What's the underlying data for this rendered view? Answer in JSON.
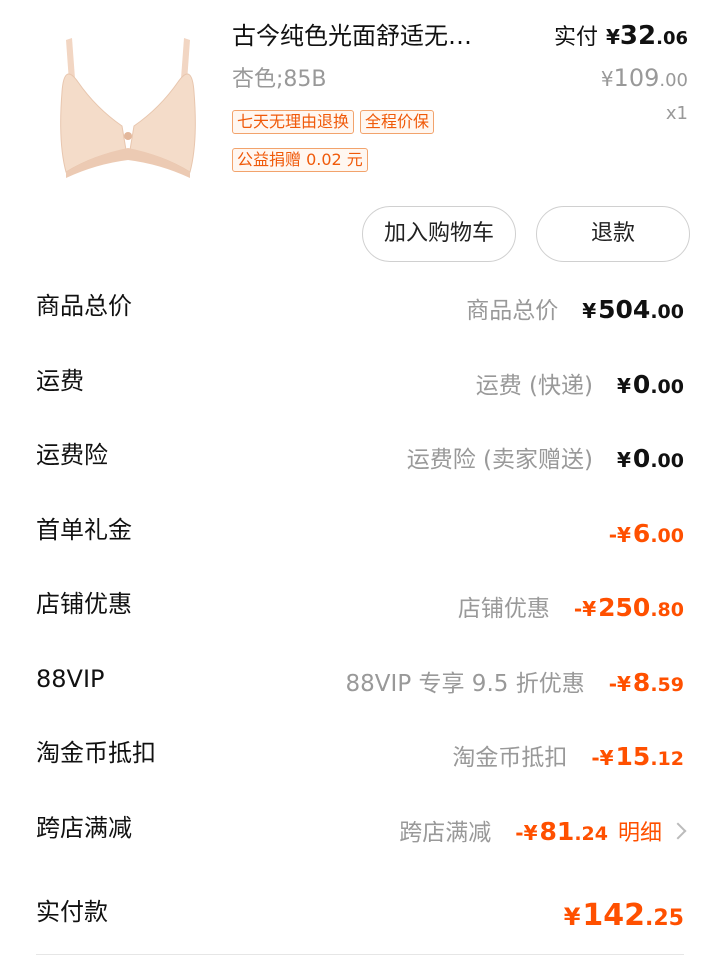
{
  "product": {
    "name": "古今纯色光面舒适无…",
    "sku": "杏色;85B",
    "tags": [
      "七天无理由退换",
      "全程价保",
      "公益捐赠 0.02 元"
    ],
    "paid_label": "实付",
    "paid_symbol": "¥",
    "paid_int": "32",
    "paid_dec": ".06",
    "orig_symbol": "¥",
    "orig_int": "109",
    "orig_dec": ".00",
    "quantity": "x1",
    "image_icon": "bra-product-image"
  },
  "actions": {
    "add_to_cart": "加入购物车",
    "refund": "退款"
  },
  "fees": [
    {
      "label": "商品总价",
      "desc": "商品总价",
      "sign": "¥",
      "int": "504",
      "dec": ".00",
      "style": "dark"
    },
    {
      "label": "运费",
      "desc": "运费 (快递)",
      "sign": "¥",
      "int": "0",
      "dec": ".00",
      "style": "dark"
    },
    {
      "label": "运费险",
      "desc": "运费险 (卖家赠送)",
      "sign": "¥",
      "int": "0",
      "dec": ".00",
      "style": "dark"
    },
    {
      "label": "首单礼金",
      "desc": "",
      "sign": "-¥",
      "int": "6",
      "dec": ".00",
      "style": "orange"
    },
    {
      "label": "店铺优惠",
      "desc": "店铺优惠",
      "sign": "-¥",
      "int": "250",
      "dec": ".80",
      "style": "orange"
    },
    {
      "label": "88VIP",
      "desc": "88VIP 专享 9.5 折优惠",
      "sign": "-¥",
      "int": "8",
      "dec": ".59",
      "style": "orange"
    },
    {
      "label": "淘金币抵扣",
      "desc": "淘金币抵扣",
      "sign": "-¥",
      "int": "15",
      "dec": ".12",
      "style": "orange"
    },
    {
      "label": "跨店满减",
      "desc": "跨店满减",
      "sign": "-¥",
      "int": "81",
      "dec": ".24",
      "style": "orange",
      "detail": "明细"
    }
  ],
  "total": {
    "label": "实付款",
    "sign": "¥",
    "int": "142",
    "dec": ".25"
  },
  "colors": {
    "accent": "#ff5000",
    "muted": "#999999",
    "tag_border": "#f2a36c"
  }
}
